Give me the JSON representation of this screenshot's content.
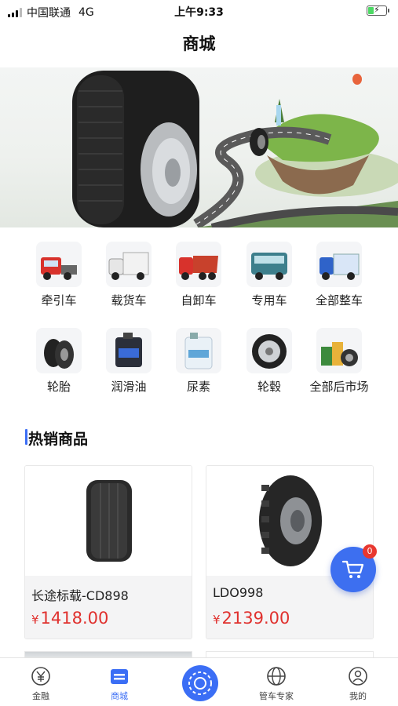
{
  "status_bar": {
    "carrier": "中国联通",
    "network": "4G",
    "time": "上午9:33",
    "battery_level": 0.35
  },
  "nav": {
    "title": "商城"
  },
  "categories": [
    {
      "label": "牵引车",
      "icon": "tractor-truck-icon"
    },
    {
      "label": "载货车",
      "icon": "cargo-truck-icon"
    },
    {
      "label": "自卸车",
      "icon": "dump-truck-icon"
    },
    {
      "label": "专用车",
      "icon": "special-truck-icon"
    },
    {
      "label": "全部整车",
      "icon": "all-trucks-icon"
    },
    {
      "label": "轮胎",
      "icon": "tire-icon"
    },
    {
      "label": "润滑油",
      "icon": "lubricant-icon"
    },
    {
      "label": "尿素",
      "icon": "urea-icon"
    },
    {
      "label": "轮毂",
      "icon": "wheel-hub-icon"
    },
    {
      "label": "全部后市场",
      "icon": "aftermarket-icon"
    }
  ],
  "hot_section": {
    "title": "热销商品"
  },
  "products": [
    {
      "name": "长途标载-CD898",
      "currency": "¥",
      "price": "1418.00",
      "icon": "tire-image"
    },
    {
      "name": "LDO998",
      "currency": "¥",
      "price": "2139.00",
      "icon": "tire-image"
    }
  ],
  "cart": {
    "badge_count": "0",
    "icon": "cart-icon"
  },
  "tabs": [
    {
      "label": "金融",
      "icon": "yen-icon",
      "active": false
    },
    {
      "label": "商城",
      "icon": "shop-icon",
      "active": true
    },
    {
      "label": "",
      "icon": "center-logo-icon",
      "active": false
    },
    {
      "label": "管车专家",
      "icon": "globe-icon",
      "active": false
    },
    {
      "label": "我的",
      "icon": "user-icon",
      "active": false
    }
  ],
  "colors": {
    "accent": "#3b6ef5",
    "price": "#e0312e",
    "badge": "#e8372f"
  }
}
